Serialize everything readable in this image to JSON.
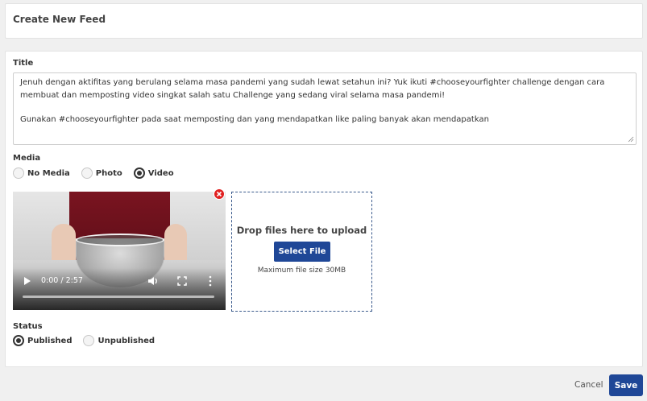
{
  "header": {
    "title": "Create New Feed"
  },
  "form": {
    "title_label": "Title",
    "title_paragraphs": [
      "Jenuh dengan aktifitas yang berulang selama masa pandemi yang sudah lewat setahun ini? Yuk ikuti #chooseyourfighter challenge dengan cara membuat dan memposting video singkat salah satu Challenge yang sedang viral selama masa pandemi!",
      "Gunakan #chooseyourfighter pada saat memposting dan yang mendapatkan like paling banyak akan mendapatkan"
    ],
    "media_label": "Media",
    "media_options": [
      {
        "label": "No Media",
        "checked": false
      },
      {
        "label": "Photo",
        "checked": false
      },
      {
        "label": "Video",
        "checked": true
      }
    ],
    "video": {
      "time": "0:00 / 2:57"
    },
    "dropzone": {
      "title": "Drop files here to upload",
      "button": "Select File",
      "hint": "Maximum file size 30MB"
    },
    "status_label": "Status",
    "status_options": [
      {
        "label": "Published",
        "checked": true
      },
      {
        "label": "Unpublished",
        "checked": false
      }
    ]
  },
  "footer": {
    "cancel": "Cancel",
    "save": "Save"
  },
  "colors": {
    "primary": "#1f4797",
    "remove": "#e02020",
    "dropzone_border": "#3a5a8c"
  }
}
